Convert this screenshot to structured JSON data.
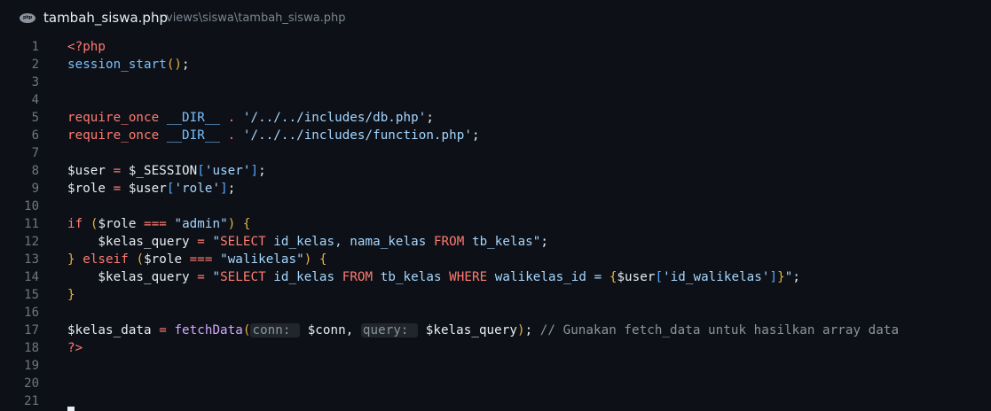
{
  "header": {
    "file_name": "tambah_siswa.php",
    "file_path": "views\\siswa\\tambah_siswa.php",
    "icon": "php-file-icon",
    "icon_text": "php"
  },
  "editor": {
    "lines": [
      {
        "n": "1",
        "tokens": [
          {
            "t": "<?php",
            "c": "kw"
          }
        ]
      },
      {
        "n": "2",
        "tokens": [
          {
            "t": "session_start",
            "c": "ct"
          },
          {
            "t": "()",
            "c": "br1"
          },
          {
            "t": ";",
            "c": "pn"
          }
        ]
      },
      {
        "n": "3",
        "tokens": []
      },
      {
        "n": "4",
        "tokens": []
      },
      {
        "n": "5",
        "tokens": [
          {
            "t": "require_once",
            "c": "kw"
          },
          {
            "t": " ",
            "c": "pn"
          },
          {
            "t": "__DIR__",
            "c": "ct"
          },
          {
            "t": " . ",
            "c": "op"
          },
          {
            "t": "'/../../includes/db.php'",
            "c": "st"
          },
          {
            "t": ";",
            "c": "pn"
          }
        ]
      },
      {
        "n": "6",
        "tokens": [
          {
            "t": "require_once",
            "c": "kw"
          },
          {
            "t": " ",
            "c": "pn"
          },
          {
            "t": "__DIR__",
            "c": "ct"
          },
          {
            "t": " . ",
            "c": "op"
          },
          {
            "t": "'/../../includes/function.php'",
            "c": "st"
          },
          {
            "t": ";",
            "c": "pn"
          }
        ]
      },
      {
        "n": "7",
        "tokens": []
      },
      {
        "n": "8",
        "tokens": [
          {
            "t": "$user",
            "c": "vr"
          },
          {
            "t": " = ",
            "c": "op"
          },
          {
            "t": "$_SESSION",
            "c": "vr"
          },
          {
            "t": "[",
            "c": "br3"
          },
          {
            "t": "'user'",
            "c": "st"
          },
          {
            "t": "]",
            "c": "br3"
          },
          {
            "t": ";",
            "c": "pn"
          }
        ]
      },
      {
        "n": "9",
        "tokens": [
          {
            "t": "$role",
            "c": "vr"
          },
          {
            "t": " = ",
            "c": "op"
          },
          {
            "t": "$user",
            "c": "vr"
          },
          {
            "t": "[",
            "c": "br3"
          },
          {
            "t": "'role'",
            "c": "st"
          },
          {
            "t": "]",
            "c": "br3"
          },
          {
            "t": ";",
            "c": "pn"
          }
        ]
      },
      {
        "n": "10",
        "tokens": []
      },
      {
        "n": "11",
        "tokens": [
          {
            "t": "if",
            "c": "kw"
          },
          {
            "t": " ",
            "c": "pn"
          },
          {
            "t": "(",
            "c": "br1"
          },
          {
            "t": "$role",
            "c": "vr"
          },
          {
            "t": " === ",
            "c": "op"
          },
          {
            "t": "\"admin\"",
            "c": "st"
          },
          {
            "t": ")",
            "c": "br1"
          },
          {
            "t": " ",
            "c": "pn"
          },
          {
            "t": "{",
            "c": "br1"
          }
        ]
      },
      {
        "n": "12",
        "tokens": [
          {
            "t": "    $kelas_query",
            "c": "vr"
          },
          {
            "t": " = ",
            "c": "op"
          },
          {
            "t": "\"",
            "c": "st"
          },
          {
            "t": "SELECT",
            "c": "kw"
          },
          {
            "t": " id_kelas, nama_kelas ",
            "c": "st"
          },
          {
            "t": "FROM",
            "c": "kw"
          },
          {
            "t": " tb_kelas\"",
            "c": "st"
          },
          {
            "t": ";",
            "c": "pn"
          }
        ]
      },
      {
        "n": "13",
        "tokens": [
          {
            "t": "}",
            "c": "br1"
          },
          {
            "t": " ",
            "c": "pn"
          },
          {
            "t": "elseif",
            "c": "kw"
          },
          {
            "t": " ",
            "c": "pn"
          },
          {
            "t": "(",
            "c": "br1"
          },
          {
            "t": "$role",
            "c": "vr"
          },
          {
            "t": " === ",
            "c": "op"
          },
          {
            "t": "\"walikelas\"",
            "c": "st"
          },
          {
            "t": ")",
            "c": "br1"
          },
          {
            "t": " ",
            "c": "pn"
          },
          {
            "t": "{",
            "c": "br1"
          }
        ]
      },
      {
        "n": "14",
        "tokens": [
          {
            "t": "    $kelas_query",
            "c": "vr"
          },
          {
            "t": " = ",
            "c": "op"
          },
          {
            "t": "\"",
            "c": "st"
          },
          {
            "t": "SELECT",
            "c": "kw"
          },
          {
            "t": " id_kelas ",
            "c": "st"
          },
          {
            "t": "FROM",
            "c": "kw"
          },
          {
            "t": " tb_kelas ",
            "c": "st"
          },
          {
            "t": "WHERE",
            "c": "kw"
          },
          {
            "t": " walikelas_id = ",
            "c": "st"
          },
          {
            "t": "{",
            "c": "br1"
          },
          {
            "t": "$user",
            "c": "vr"
          },
          {
            "t": "[",
            "c": "br3"
          },
          {
            "t": "'id_walikelas'",
            "c": "st"
          },
          {
            "t": "]",
            "c": "br3"
          },
          {
            "t": "}",
            "c": "br1"
          },
          {
            "t": "\"",
            "c": "st"
          },
          {
            "t": ";",
            "c": "pn"
          }
        ]
      },
      {
        "n": "15",
        "tokens": [
          {
            "t": "}",
            "c": "br1"
          }
        ]
      },
      {
        "n": "16",
        "tokens": []
      },
      {
        "n": "17",
        "tokens": [
          {
            "t": "$kelas_data",
            "c": "vr"
          },
          {
            "t": " = ",
            "c": "op"
          },
          {
            "t": "fetchData",
            "c": "fnc"
          },
          {
            "t": "(",
            "c": "br1"
          },
          {
            "t": "conn: ",
            "c": "hint"
          },
          {
            "t": " $conn, ",
            "c": "vr"
          },
          {
            "t": "query: ",
            "c": "hint"
          },
          {
            "t": " $kelas_query",
            "c": "vr"
          },
          {
            "t": ")",
            "c": "br1"
          },
          {
            "t": "; ",
            "c": "pn"
          },
          {
            "t": "// Gunakan fetch_data untuk hasilkan array data",
            "c": "cm"
          }
        ]
      },
      {
        "n": "18",
        "tokens": [
          {
            "t": "?>",
            "c": "kw"
          }
        ]
      },
      {
        "n": "19",
        "tokens": []
      },
      {
        "n": "20",
        "tokens": []
      },
      {
        "n": "21",
        "tokens": []
      }
    ]
  },
  "colors": {
    "background": "#0d1117",
    "keyword": "#ff7b72",
    "constant": "#79c0ff",
    "string": "#a5d6ff",
    "function": "#d2a8ff",
    "bracket": "#e3b341",
    "comment": "#8b949e",
    "line_number": "#6e7681"
  }
}
